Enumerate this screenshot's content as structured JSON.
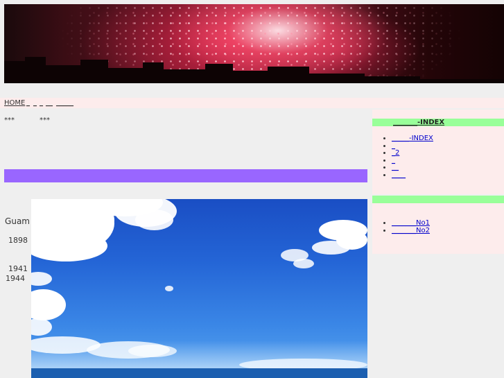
{
  "banner": {
    "image_name": "fireworks-banner"
  },
  "nav": {
    "items": [
      {
        "label": "HOME"
      },
      {
        "label": "_"
      },
      {
        "label": "_"
      },
      {
        "label": "_"
      },
      {
        "label": "__"
      },
      {
        "label": "_____"
      }
    ]
  },
  "intro": {
    "left": "***",
    "right": "***"
  },
  "side": {
    "place": "Guam",
    "year1": "1898",
    "year2": "1941",
    "year3": "1944"
  },
  "sky_image": {
    "image_name": "blue-sky-clouds-photo"
  },
  "right_col": {
    "box1": {
      "header": "-INDEX",
      "header_prefix": "_______",
      "links": [
        {
          "label": "-INDEX",
          "prefix": "_____"
        },
        {
          "label": "_"
        },
        {
          "label": "_2"
        },
        {
          "label": "_"
        },
        {
          "label": "__"
        },
        {
          "label": "____"
        }
      ]
    },
    "box2": {
      "header": "",
      "links": [
        {
          "label": "No1",
          "prefix": "_______"
        },
        {
          "label": "No2",
          "prefix": "_______"
        }
      ]
    }
  },
  "colors": {
    "page_bg": "#efefef",
    "nav_bg": "#fdecec",
    "purple_bar": "#9966ff",
    "green_header": "#99ff99",
    "link": "#0000cc"
  }
}
